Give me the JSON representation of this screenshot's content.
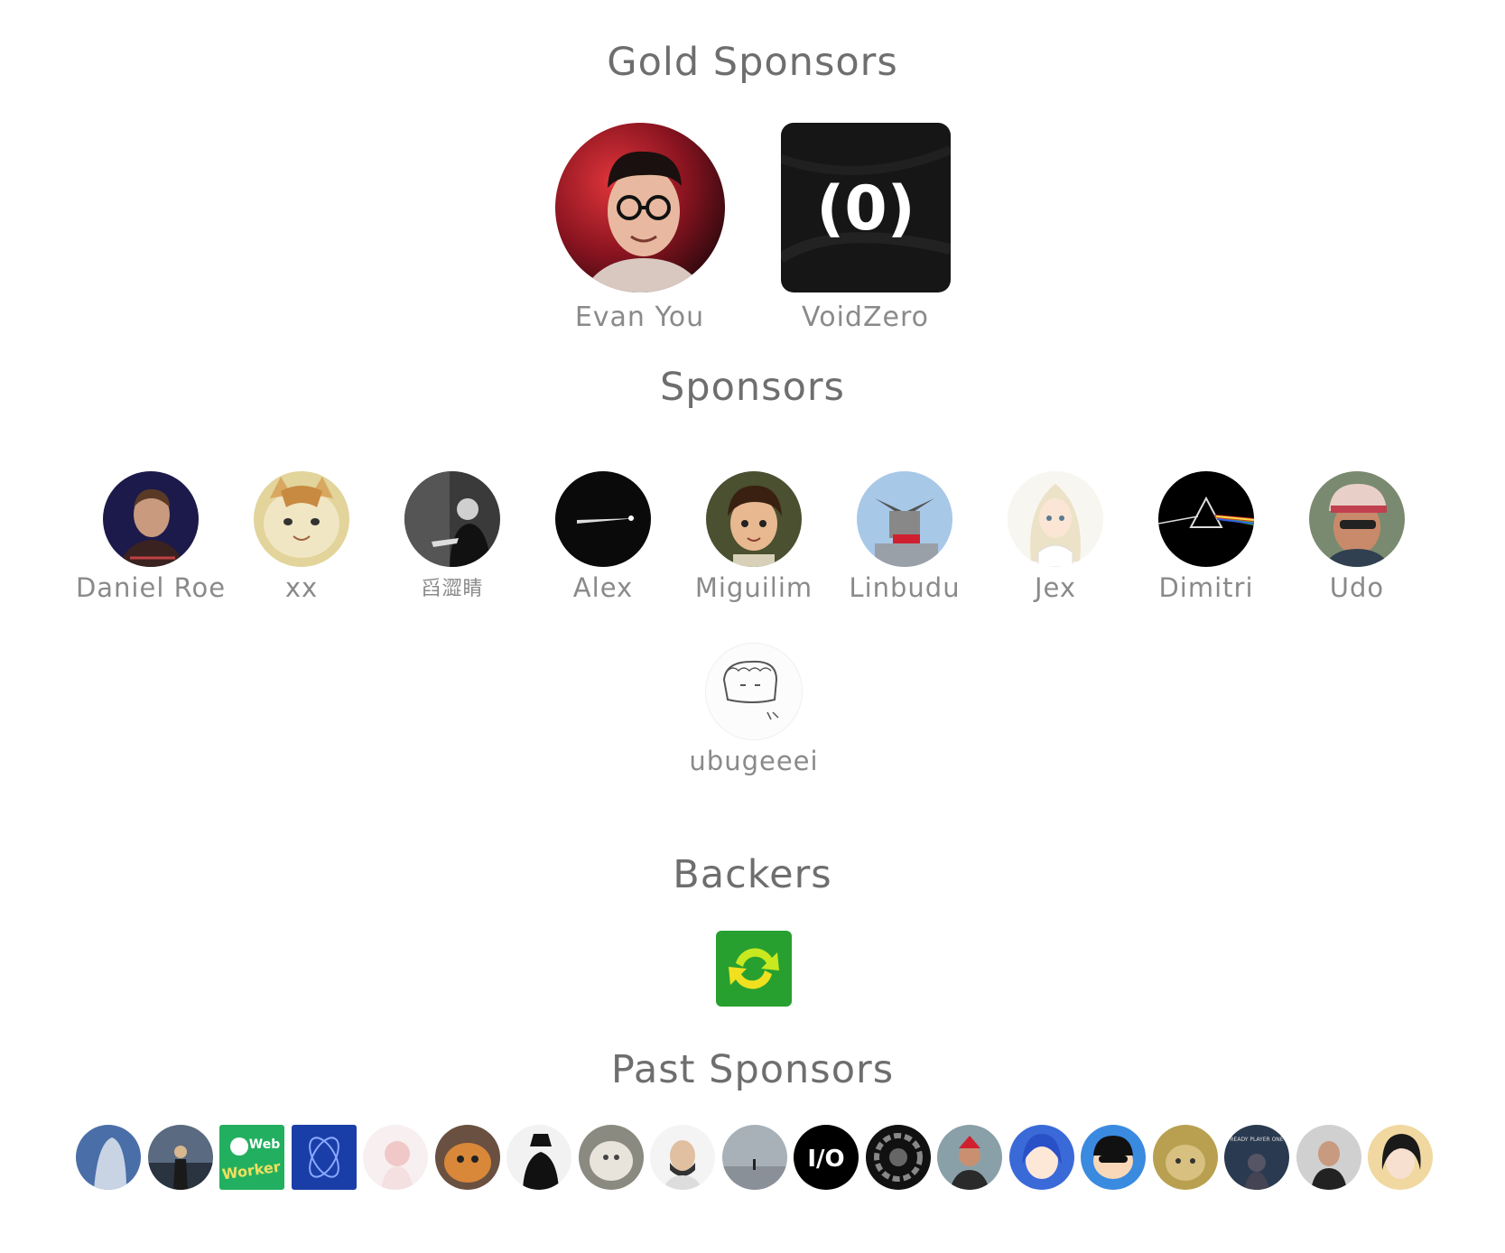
{
  "sections": {
    "gold_title": "Gold Sponsors",
    "sponsors_title": "Sponsors",
    "backers_title": "Backers",
    "past_title": "Past Sponsors"
  },
  "gold": [
    {
      "name": "Evan You",
      "icon": "evan-you-avatar"
    },
    {
      "name": "VoidZero",
      "icon": "voidzero-logo",
      "logo_text": "(0)"
    }
  ],
  "sponsors": [
    {
      "name": "Daniel Roe",
      "icon": "daniel-roe-avatar"
    },
    {
      "name": "xx",
      "icon": "cat-avatar"
    },
    {
      "name": "舀澀睛",
      "icon": "person-bw-avatar"
    },
    {
      "name": "Alex",
      "icon": "comet-avatar"
    },
    {
      "name": "Miguilim",
      "icon": "anime-boy-avatar"
    },
    {
      "name": "Linbudu",
      "icon": "gundam-avatar"
    },
    {
      "name": "Jex",
      "icon": "anime-girl-avatar"
    },
    {
      "name": "Dimitri",
      "icon": "prism-avatar"
    },
    {
      "name": "Udo",
      "icon": "man-cap-avatar"
    },
    {
      "name": "ubugeeei",
      "icon": "sketch-avatar"
    }
  ],
  "backers": [
    {
      "icon": "green-sync-logo"
    }
  ],
  "past_sponsors": [
    {
      "icon": "past-avatar-1"
    },
    {
      "icon": "past-avatar-2"
    },
    {
      "icon": "web-worker-logo"
    },
    {
      "icon": "blue-atom-logo"
    },
    {
      "icon": "past-avatar-5"
    },
    {
      "icon": "past-avatar-6"
    },
    {
      "icon": "past-avatar-7"
    },
    {
      "icon": "past-avatar-8"
    },
    {
      "icon": "past-avatar-9"
    },
    {
      "icon": "past-avatar-10"
    },
    {
      "icon": "io-logo"
    },
    {
      "icon": "past-avatar-12"
    },
    {
      "icon": "past-avatar-13"
    },
    {
      "icon": "past-avatar-14"
    },
    {
      "icon": "past-avatar-15"
    },
    {
      "icon": "past-avatar-16"
    },
    {
      "icon": "ready-player-one-avatar"
    },
    {
      "icon": "past-avatar-18"
    },
    {
      "icon": "past-avatar-19"
    }
  ],
  "past_logo_text": {
    "io": "I/O",
    "ready_player": "READY PLAYER ONE",
    "web_worker": "Web Worker"
  }
}
